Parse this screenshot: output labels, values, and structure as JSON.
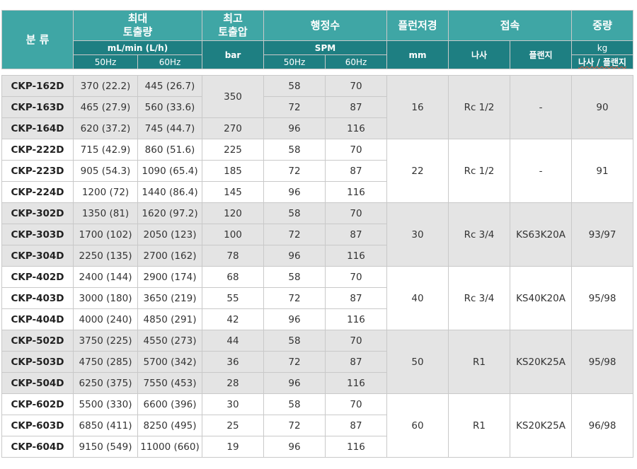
{
  "header": {
    "classification": "분 류",
    "max_discharge": "최대\n토출량",
    "max_pressure": "최고\n토출압",
    "strokes": "행정수",
    "plunger_dia": "플런저경",
    "connection": "접속",
    "weight": "중량",
    "flow_unit": "mL/min (L/h)",
    "pressure_unit": "bar",
    "strokes_unit": "SPM",
    "dia_unit": "mm",
    "thread": "나사",
    "flange": "플랜지",
    "weight_unit": "kg",
    "hz50": "50Hz",
    "hz60": "60Hz",
    "weight_sub": "나사 / 플랜지"
  },
  "groups": [
    {
      "shade": "gray",
      "plunger": "16",
      "thread": "Rc 1/2",
      "flange": "-",
      "weight": "90",
      "rows": [
        {
          "model": "CKP-162D",
          "flow50": "370 (22.2)",
          "flow60": "445 (26.7)",
          "spm50": "58",
          "spm60": "70"
        },
        {
          "model": "CKP-163D",
          "flow50": "465 (27.9)",
          "flow60": "560 (33.6)",
          "spm50": "72",
          "spm60": "87"
        },
        {
          "model": "CKP-164D",
          "flow50": "620 (37.2)",
          "flow60": "745 (44.7)",
          "spm50": "96",
          "spm60": "116"
        }
      ],
      "pressure": [
        {
          "value": "350",
          "span": 2
        },
        {
          "value": "270",
          "span": 1
        }
      ]
    },
    {
      "shade": "white",
      "plunger": "22",
      "thread": "Rc 1/2",
      "flange": "-",
      "weight": "91",
      "rows": [
        {
          "model": "CKP-222D",
          "flow50": "715 (42.9)",
          "flow60": "860 (51.6)",
          "spm50": "58",
          "spm60": "70"
        },
        {
          "model": "CKP-223D",
          "flow50": "905 (54.3)",
          "flow60": "1090 (65.4)",
          "spm50": "72",
          "spm60": "87"
        },
        {
          "model": "CKP-224D",
          "flow50": "1200 (72)",
          "flow60": "1440 (86.4)",
          "spm50": "96",
          "spm60": "116"
        }
      ],
      "pressure": [
        {
          "value": "225",
          "span": 1
        },
        {
          "value": "185",
          "span": 1
        },
        {
          "value": "145",
          "span": 1
        }
      ]
    },
    {
      "shade": "gray",
      "plunger": "30",
      "thread": "Rc 3/4",
      "flange": "KS63K20A",
      "weight": "93/97",
      "rows": [
        {
          "model": "CKP-302D",
          "flow50": "1350 (81)",
          "flow60": "1620 (97.2)",
          "spm50": "58",
          "spm60": "70"
        },
        {
          "model": "CKP-303D",
          "flow50": "1700 (102)",
          "flow60": "2050 (123)",
          "spm50": "72",
          "spm60": "87"
        },
        {
          "model": "CKP-304D",
          "flow50": "2250 (135)",
          "flow60": "2700 (162)",
          "spm50": "96",
          "spm60": "116"
        }
      ],
      "pressure": [
        {
          "value": "120",
          "span": 1
        },
        {
          "value": "100",
          "span": 1
        },
        {
          "value": "78",
          "span": 1
        }
      ]
    },
    {
      "shade": "white",
      "plunger": "40",
      "thread": "Rc 3/4",
      "flange": "KS40K20A",
      "weight": "95/98",
      "rows": [
        {
          "model": "CKP-402D",
          "flow50": "2400 (144)",
          "flow60": "2900 (174)",
          "spm50": "58",
          "spm60": "70"
        },
        {
          "model": "CKP-403D",
          "flow50": "3000 (180)",
          "flow60": "3650 (219)",
          "spm50": "72",
          "spm60": "87"
        },
        {
          "model": "CKP-404D",
          "flow50": "4000 (240)",
          "flow60": "4850 (291)",
          "spm50": "96",
          "spm60": "116"
        }
      ],
      "pressure": [
        {
          "value": "68",
          "span": 1
        },
        {
          "value": "55",
          "span": 1
        },
        {
          "value": "42",
          "span": 1
        }
      ]
    },
    {
      "shade": "gray",
      "plunger": "50",
      "thread": "R1",
      "flange": "KS20K25A",
      "weight": "95/98",
      "rows": [
        {
          "model": "CKP-502D",
          "flow50": "3750 (225)",
          "flow60": "4550 (273)",
          "spm50": "58",
          "spm60": "70"
        },
        {
          "model": "CKP-503D",
          "flow50": "4750 (285)",
          "flow60": "5700 (342)",
          "spm50": "72",
          "spm60": "87"
        },
        {
          "model": "CKP-504D",
          "flow50": "6250 (375)",
          "flow60": "7550 (453)",
          "spm50": "96",
          "spm60": "116"
        }
      ],
      "pressure": [
        {
          "value": "44",
          "span": 1
        },
        {
          "value": "36",
          "span": 1
        },
        {
          "value": "28",
          "span": 1
        }
      ]
    },
    {
      "shade": "white",
      "plunger": "60",
      "thread": "R1",
      "flange": "KS20K25A",
      "weight": "96/98",
      "rows": [
        {
          "model": "CKP-602D",
          "flow50": "5500 (330)",
          "flow60": "6600 (396)",
          "spm50": "58",
          "spm60": "70"
        },
        {
          "model": "CKP-603D",
          "flow50": "6850 (411)",
          "flow60": "8250 (495)",
          "spm50": "72",
          "spm60": "87"
        },
        {
          "model": "CKP-604D",
          "flow50": "9150 (549)",
          "flow60": "11000 (660)",
          "spm50": "96",
          "spm60": "116"
        }
      ],
      "pressure": [
        {
          "value": "30",
          "span": 1
        },
        {
          "value": "25",
          "span": 1
        },
        {
          "value": "19",
          "span": 1
        }
      ]
    }
  ]
}
